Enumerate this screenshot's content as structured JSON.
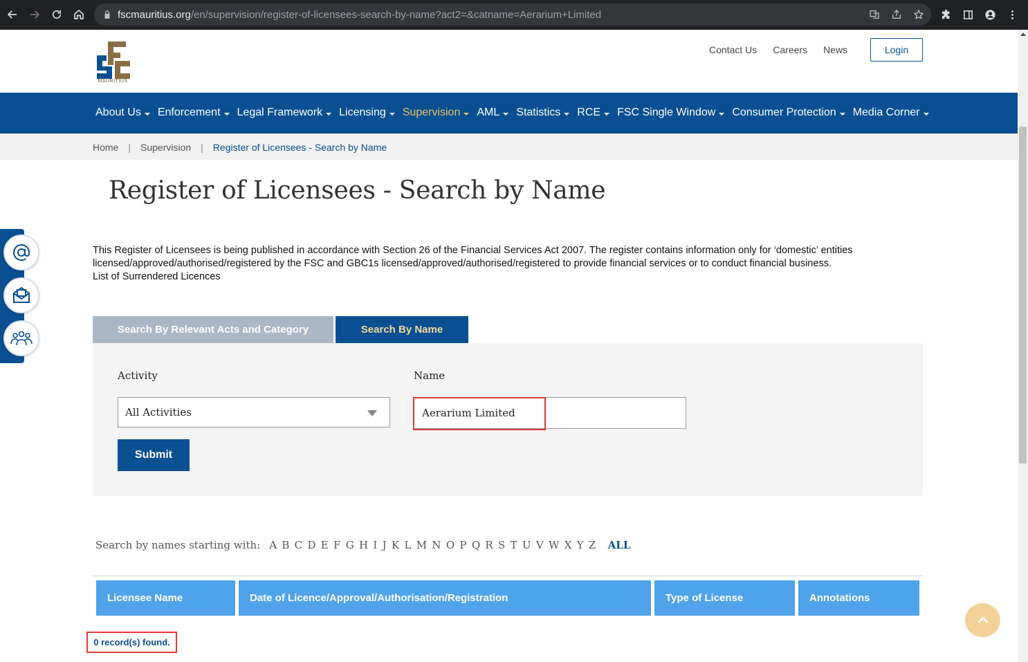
{
  "browser": {
    "url_host": "fscmauritius.org",
    "url_path": "/en/supervision/register-of-licensees-search-by-name?act2=&catname=Aerarium+Limited"
  },
  "header": {
    "logo_text": "MAURITIUS",
    "top_links": [
      "Contact Us",
      "Careers",
      "News"
    ],
    "login_label": "Login"
  },
  "nav": {
    "items": [
      {
        "label": "About Us"
      },
      {
        "label": "Enforcement"
      },
      {
        "label": "Legal Framework"
      },
      {
        "label": "Licensing"
      },
      {
        "label": "Supervision"
      },
      {
        "label": "AML"
      },
      {
        "label": "Statistics"
      },
      {
        "label": "RCE"
      },
      {
        "label": "FSC Single Window"
      },
      {
        "label": "Consumer Protection"
      },
      {
        "label": "Media Corner"
      }
    ],
    "active_index": 4
  },
  "breadcrumb": {
    "home": "Home",
    "section": "Supervision",
    "current": "Register of Licensees - Search by Name",
    "sep": "|"
  },
  "page": {
    "title": "Register of Licensees - Search by Name",
    "intro_line1": "This Register of Licensees is being published in accordance with Section 26 of the Financial Services Act 2007. The register contains information only for ‘domestic’ entities",
    "intro_line2": "licensed/approved/authorised/registered by the FSC and GBC1s licensed/approved/authorised/registered to provide financial services or to conduct financial business.",
    "surrendered_link": "List of Surrendered Licences"
  },
  "tabs": {
    "acts": "Search By Relevant Acts and Category",
    "name": "Search By Name"
  },
  "form": {
    "activity_label": "Activity",
    "activity_value": "All Activities",
    "name_label": "Name",
    "name_value": "Aerarium Limited",
    "submit_label": "Submit"
  },
  "alphabet": {
    "label": "Search by names starting with:",
    "letters": [
      "A",
      "B",
      "C",
      "D",
      "E",
      "F",
      "G",
      "H",
      "I",
      "J",
      "K",
      "L",
      "M",
      "N",
      "O",
      "P",
      "Q",
      "R",
      "S",
      "T",
      "U",
      "V",
      "W",
      "X",
      "Y",
      "Z"
    ],
    "all": "ALL"
  },
  "table": {
    "columns": [
      "Licensee Name",
      "Date of Licence/Approval/Authorisation/Registration",
      "Type of License",
      "Annotations"
    ]
  },
  "results": {
    "count_text": "0 record(s) found."
  },
  "colors": {
    "brand_blue": "#0a4f92",
    "accent_gold": "#e8c36b",
    "table_header": "#4fa3ea",
    "highlight_red": "#e03a3a"
  },
  "icons": [
    "back-icon",
    "forward-icon",
    "reload-icon",
    "home-icon",
    "lock-icon",
    "translate-icon",
    "share-icon",
    "star-icon",
    "extensions-icon",
    "sidepanel-icon",
    "profile-icon",
    "menu-icon",
    "at-icon",
    "mail-icon",
    "people-icon",
    "chevron-up-icon"
  ]
}
